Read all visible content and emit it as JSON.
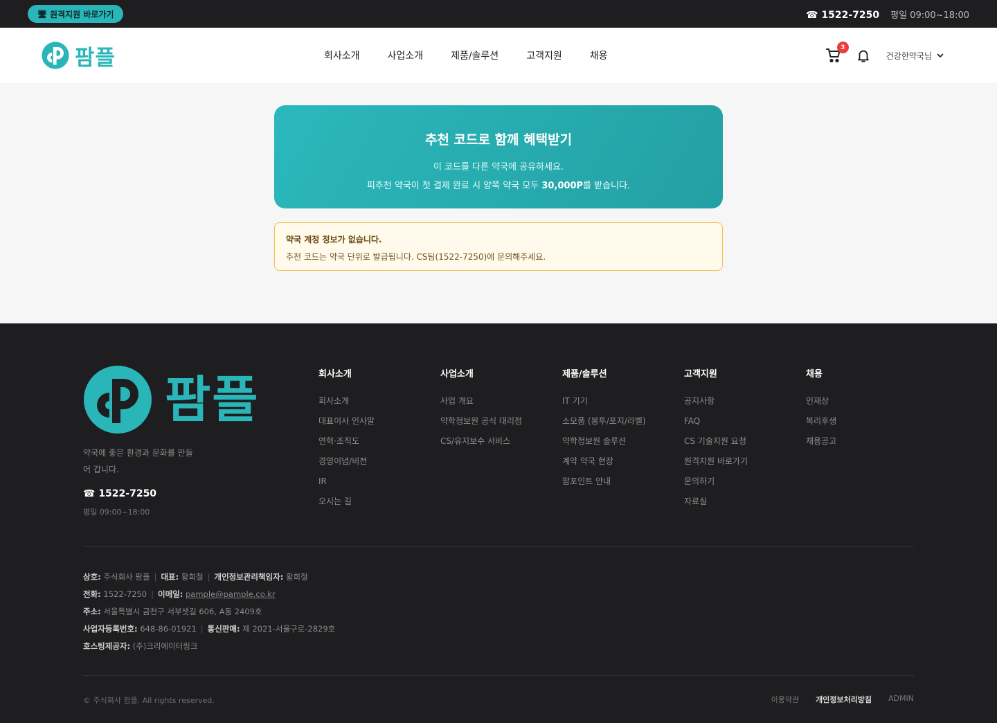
{
  "topbar": {
    "remote_label": "원격지원 바로가기",
    "remote_icon": "monitor-icon",
    "phone": "☎ 1522-7250",
    "hours": "평일 09:00~18:00"
  },
  "header": {
    "logo_text": "팜플",
    "nav": [
      "회사소개",
      "사업소개",
      "제품/솔루션",
      "고객지원",
      "채용"
    ],
    "cart_count": "3",
    "user_name": "건강한약국님",
    "brand_color": "#2ab5b9"
  },
  "referral": {
    "title": "추천 코드로 함께 혜택받기",
    "line1": "이 코드를 다른 약국에 공유하세요.",
    "line2_prefix": "피추천 약국이 첫 결제 완료 시 양쪽 약국 모두 ",
    "line2_bold": "30,000P",
    "line2_suffix": "를 받습니다."
  },
  "notice": {
    "title": "약국 계정 정보가 없습니다.",
    "body": "추천 코드는 약국 단위로 발급됩니다. CS팀(1522-7250)에 문의해주세요."
  },
  "footer": {
    "logo_text": "팜플",
    "slogan": "약국에 좋은 환경과 문화를 만들어 갑니다.",
    "phone": "☎ 1522-7250",
    "hours": "평일 09:00~18:00",
    "columns": [
      {
        "title": "회사소개",
        "links": [
          "회사소개",
          "대표이사 인사말",
          "연혁·조직도",
          "경영이념/비전",
          "IR",
          "오시는 길"
        ]
      },
      {
        "title": "사업소개",
        "links": [
          "사업 개요",
          "약학정보원 공식 대리점",
          "CS/유지보수 서비스"
        ]
      },
      {
        "title": "제품/솔루션",
        "links": [
          "IT 기기",
          "소모품 (봉투/포지/라벨)",
          "약학정보원 솔루션",
          "계약 약국 현장",
          "팜포인트 안내"
        ]
      },
      {
        "title": "고객지원",
        "links": [
          "공지사항",
          "FAQ",
          "CS 기술지원 요청",
          "원격지원 바로가기",
          "문의하기",
          "자료실"
        ]
      },
      {
        "title": "채용",
        "links": [
          "인재상",
          "복리후생",
          "채용공고"
        ]
      }
    ],
    "info": {
      "company_label": "상호:",
      "company": "주식회사 팜플",
      "ceo_label": "대표:",
      "ceo": "황희철",
      "privacy_label": "개인정보관리책임자:",
      "privacy": "황희철",
      "tel_label": "전화:",
      "tel": "1522-7250",
      "email_label": "이메일:",
      "email": "pample@pample.co.kr",
      "address_label": "주소:",
      "address": "서울특별시 금천구 서부샛길 606, A동 2409호",
      "bizno_label": "사업자등록번호:",
      "bizno": "648-86-01921",
      "mailorder_label": "통신판매:",
      "mailorder": "제 2021-서울구로-2829호",
      "hosting_label": "호스팅제공자:",
      "hosting": "(주)크리에이터링크"
    },
    "copyright": "© 주식회사 팜플. All rights reserved.",
    "bottom_links": [
      "이용약관",
      "개인정보처리방침",
      "ADMIN"
    ]
  }
}
